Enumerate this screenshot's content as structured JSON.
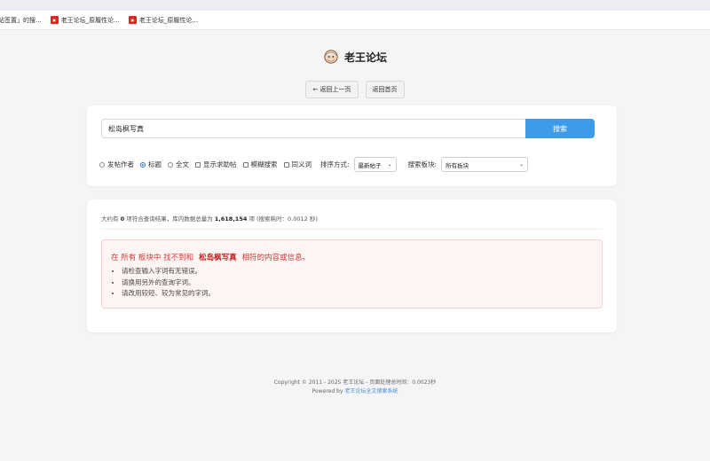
{
  "bookmarks": [
    {
      "label": "站签置」的搜...",
      "icon": ""
    },
    {
      "label": "老王论坛_原履性论...",
      "icon": "forum-favicon"
    },
    {
      "label": "老王论坛_原履性论...",
      "icon": "forum-favicon"
    }
  ],
  "header": {
    "title": "老王论坛"
  },
  "nav": {
    "back_label": "← 返回上一页",
    "home_label": "返回首页"
  },
  "search": {
    "value": "松岛枫写真",
    "button_label": "搜索",
    "options": [
      {
        "label": "发帖作者",
        "type": "radio",
        "checked": false
      },
      {
        "label": "标题",
        "type": "radio",
        "checked": true
      },
      {
        "label": "全文",
        "type": "radio",
        "checked": false
      },
      {
        "label": "显示求助帖",
        "type": "checkbox",
        "checked": false
      },
      {
        "label": "模糊搜索",
        "type": "checkbox",
        "checked": false
      },
      {
        "label": "同义词",
        "type": "checkbox",
        "checked": false
      }
    ],
    "sort_label": "排序方式:",
    "sort_value": "最新帖子",
    "board_label": "搜索板块:",
    "board_value": "所有板块"
  },
  "results": {
    "stats_prefix": "大约有",
    "count": "0",
    "stats_mid": "项符合查询结果，库内数据总量为",
    "total": "1,618,154",
    "stats_suffix": "项 (搜索耗时：0.0012 秒)",
    "notice_prefix": "在 所有 板块中 找不到和",
    "notice_keyword": "松岛枫写真",
    "notice_suffix": "相符的内容或信息。",
    "tips": [
      "请检查输入字词有无错误。",
      "请换用另外的查询字词。",
      "请改用较短、较为常见的字词。"
    ]
  },
  "footer": {
    "line1": "Copyright © 2011 - 2025 老王论坛 - 页面处理总时间：0.0023秒",
    "powered_prefix": "Powered by",
    "powered_link": "老王论坛全文搜索系统"
  },
  "colors": {
    "accent": "#3d9be9",
    "error": "#d6382f",
    "notice_bg": "#fff4f4"
  }
}
